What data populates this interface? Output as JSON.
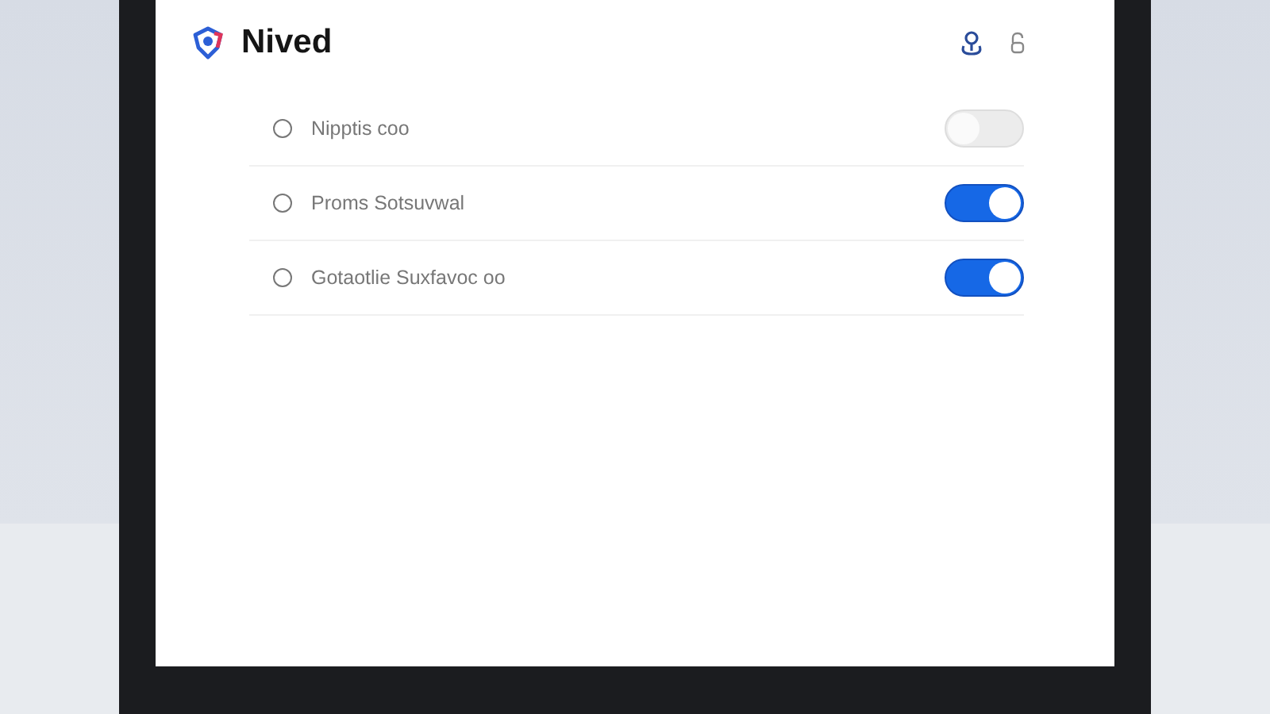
{
  "app": {
    "title": "Nived"
  },
  "settings": [
    {
      "label": "Nipptis coo",
      "selected": false,
      "on": false
    },
    {
      "label": "Proms Sotsuvwal",
      "selected": false,
      "on": true
    },
    {
      "label": "Gotaotlie Suxfavoc oo",
      "selected": false,
      "on": true
    }
  ]
}
